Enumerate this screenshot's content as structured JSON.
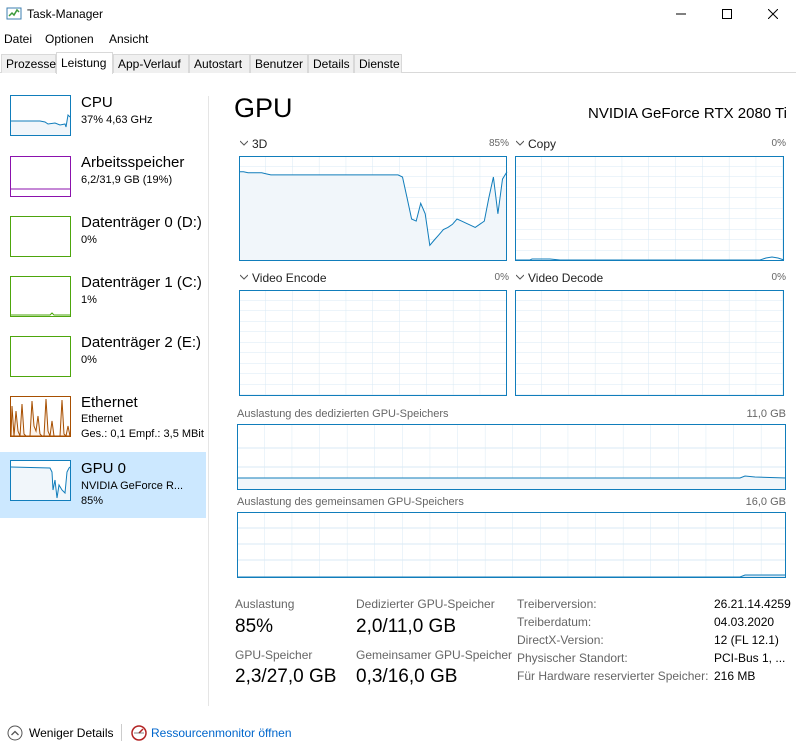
{
  "window": {
    "title": "Task-Manager"
  },
  "menu": [
    "Datei",
    "Optionen",
    "Ansicht"
  ],
  "tabs": [
    "Prozesse",
    "Leistung",
    "App-Verlauf",
    "Autostart",
    "Benutzer",
    "Details",
    "Dienste"
  ],
  "active_tab": "Leistung",
  "sidebar": [
    {
      "name": "CPU",
      "line1": "37% 4,63 GHz",
      "line2": "",
      "color": "#117dbb"
    },
    {
      "name": "Arbeitsspeicher",
      "line1": "6,2/31,9 GB (19%)",
      "line2": "",
      "color": "#8b12ae"
    },
    {
      "name": "Datenträger 0 (D:)",
      "line1": "0%",
      "line2": "",
      "color": "#4da60c"
    },
    {
      "name": "Datenträger 1 (C:)",
      "line1": "1%",
      "line2": "",
      "color": "#4da60c"
    },
    {
      "name": "Datenträger 2 (E:)",
      "line1": "0%",
      "line2": "",
      "color": "#4da60c"
    },
    {
      "name": "Ethernet",
      "line1": "Ethernet",
      "line2": "Ges.: 0,1  Empf.: 3,5 MBit",
      "color": "#a74f01"
    },
    {
      "name": "GPU 0",
      "line1": "NVIDIA GeForce R...",
      "line2": "85%",
      "color": "#117dbb"
    }
  ],
  "main": {
    "title": "GPU",
    "device": "NVIDIA GeForce RTX 2080 Ti",
    "engines": [
      {
        "name": "3D",
        "percent": "85%"
      },
      {
        "name": "Copy",
        "percent": "0%"
      },
      {
        "name": "Video Encode",
        "percent": "0%"
      },
      {
        "name": "Video Decode",
        "percent": "0%"
      }
    ],
    "dedicated_label": "Auslastung des dedizierten GPU-Speichers",
    "dedicated_max": "11,0 GB",
    "shared_label": "Auslastung des gemeinsamen GPU-Speichers",
    "shared_max": "16,0 GB"
  },
  "stats": {
    "usage_label": "Auslastung",
    "usage_value": "85%",
    "dedicated_label": "Dedizierter GPU-Speicher",
    "dedicated_value": "2,0/11,0 GB",
    "gpumem_label": "GPU-Speicher",
    "gpumem_value": "2,3/27,0 GB",
    "shared_label": "Gemeinsamer GPU-Speicher",
    "shared_value": "0,3/16,0 GB"
  },
  "info": [
    {
      "label": "Treiberversion:",
      "value": "26.21.14.4259"
    },
    {
      "label": "Treiberdatum:",
      "value": "04.03.2020"
    },
    {
      "label": "DirectX-Version:",
      "value": "12 (FL 12.1)"
    },
    {
      "label": "Physischer Standort:",
      "value": "PCI-Bus 1, ..."
    },
    {
      "label": "Für Hardware reservierter Speicher:",
      "value": "216 MB"
    }
  ],
  "footer": {
    "fewer_details": "Weniger Details",
    "resource_monitor": "Ressourcenmonitor öffnen"
  },
  "colors": {
    "gpu_line": "#117dbb",
    "gpu_fill": "#f1f6fa",
    "grid": "#d9eaf4",
    "selected": "#cce8ff"
  },
  "chart_data": {
    "type": "line",
    "x": [
      0,
      5,
      10,
      15,
      20,
      25,
      30,
      35,
      40,
      45,
      50,
      55,
      60
    ],
    "series": [
      {
        "name": "3D",
        "values": [
          85,
          85,
          84,
          84,
          84,
          84,
          83,
          82,
          82,
          82,
          82,
          82,
          82,
          82,
          82,
          82,
          82,
          82,
          82,
          82,
          82,
          82,
          82,
          82,
          82,
          82,
          82,
          82,
          82,
          82,
          82,
          82,
          82,
          82,
          82,
          82,
          80,
          60,
          40,
          38,
          55,
          45,
          15,
          20,
          25,
          30,
          32,
          35,
          40,
          38,
          36,
          34,
          32,
          35,
          38,
          60,
          80,
          45,
          78,
          85
        ]
      }
    ],
    "ylim": [
      0,
      100
    ]
  }
}
